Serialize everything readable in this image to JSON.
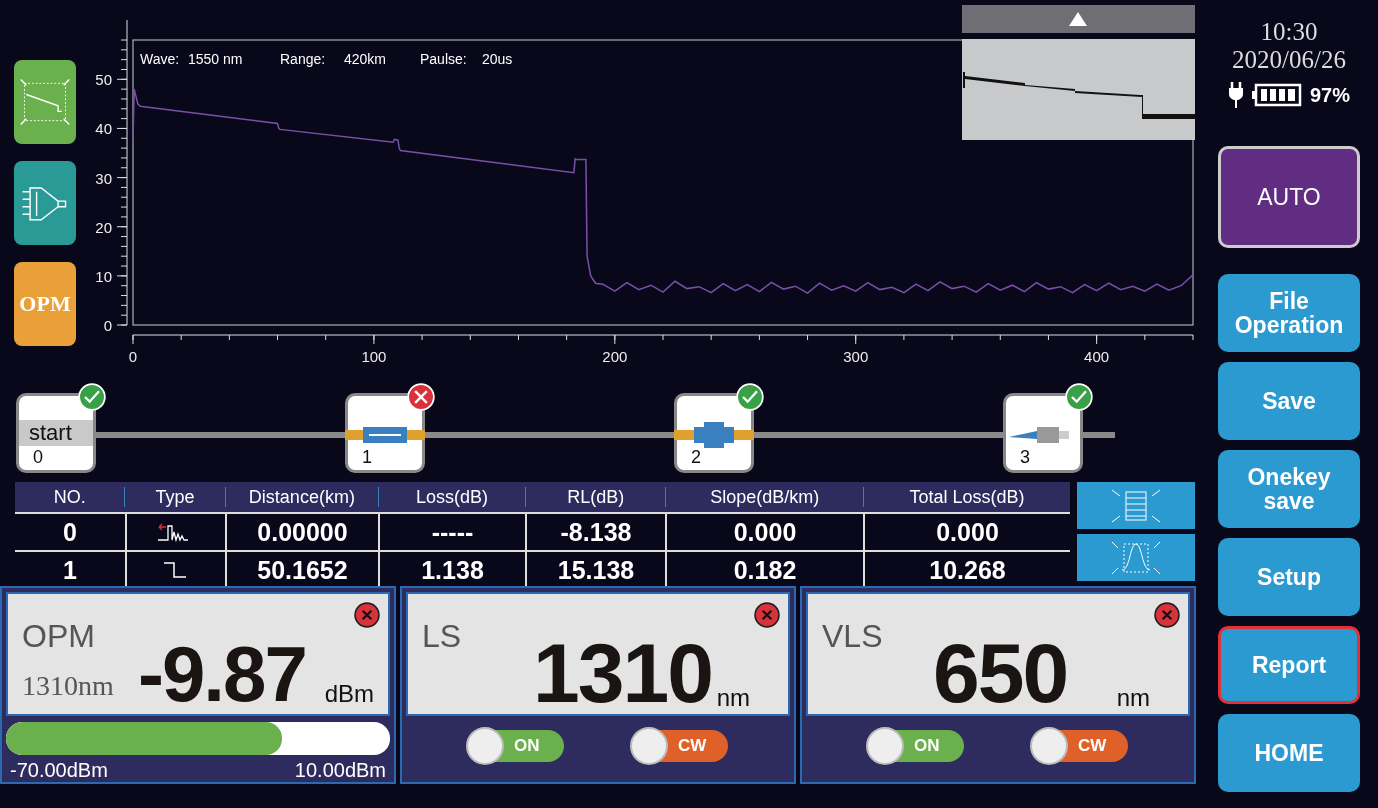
{
  "tool_buttons": [
    {
      "kind": "trace"
    },
    {
      "kind": "splitter"
    },
    {
      "kind": "text",
      "label": "OPM"
    }
  ],
  "chart": {
    "header": [
      {
        "label": "Wave:",
        "value": "1550 nm"
      },
      {
        "label": "Range:",
        "value": "420km"
      },
      {
        "label": "Paulse:",
        "value": "20us"
      }
    ],
    "chart_data": {
      "type": "line",
      "xlim": [
        0,
        440
      ],
      "ylim": [
        0,
        58
      ],
      "xticks": [
        0,
        100,
        200,
        300,
        400
      ],
      "yticks": [
        0,
        10,
        20,
        30,
        40,
        50
      ],
      "x": [
        0,
        0.5,
        1,
        2,
        3,
        60,
        60.5,
        61,
        108,
        108.5,
        110,
        110.5,
        111,
        183,
        183.5,
        184,
        188,
        188.5,
        190,
        192,
        195,
        200,
        205,
        210,
        215,
        220,
        225,
        230,
        235,
        240,
        245,
        250,
        255,
        260,
        265,
        270,
        275,
        280,
        285,
        290,
        295,
        300,
        305,
        310,
        315,
        320,
        325,
        330,
        335,
        340,
        345,
        350,
        355,
        360,
        365,
        370,
        375,
        380,
        385,
        390,
        395,
        400,
        405,
        410,
        415,
        420,
        425,
        430,
        435,
        440
      ],
      "series": [
        {
          "color": "#7b4fa8",
          "values": [
            38,
            48,
            47,
            45,
            44.5,
            41,
            40,
            39.8,
            37.2,
            37.8,
            37.6,
            36,
            35.5,
            31,
            33.8,
            33.7,
            33.7,
            14,
            10,
            8.5,
            8.3,
            6.9,
            8.6,
            7.2,
            8.1,
            6.7,
            8.9,
            7.4,
            7.8,
            6.6,
            8.4,
            7.0,
            8.2,
            6.8,
            8.7,
            7.3,
            7.9,
            6.5,
            8.5,
            7.1,
            8.0,
            6.9,
            8.6,
            7.2,
            7.7,
            6.6,
            8.3,
            7.0,
            8.8,
            7.4,
            7.9,
            6.7,
            8.4,
            7.1,
            8.1,
            6.8,
            8.6,
            7.3,
            7.8,
            6.6,
            8.2,
            7.0,
            8.5,
            7.2,
            7.9,
            6.9,
            8.3,
            7.1,
            8.0,
            10.2
          ]
        }
      ]
    }
  },
  "clock": {
    "time": "10:30",
    "date": "2020/06/26",
    "battery": "97%"
  },
  "side_buttons": [
    {
      "label": "AUTO",
      "kind": "mode",
      "selected": false
    },
    {
      "label": "File Operation",
      "kind": "action",
      "selected": false
    },
    {
      "label": "Save",
      "kind": "action",
      "selected": false
    },
    {
      "label": "Onekey save",
      "kind": "action",
      "selected": false
    },
    {
      "label": "Setup",
      "kind": "action",
      "selected": false
    },
    {
      "label": "Report",
      "kind": "action",
      "selected": true
    },
    {
      "label": "HOME",
      "kind": "action",
      "selected": false
    }
  ],
  "events": [
    {
      "kind": "start",
      "label": "start",
      "number": "0",
      "ok": true
    },
    {
      "kind": "splice",
      "number": "1",
      "ok": false
    },
    {
      "kind": "connector",
      "number": "2",
      "ok": true
    },
    {
      "kind": "end",
      "number": "3",
      "ok": true
    }
  ],
  "table": {
    "columns": [
      "NO.",
      "Type",
      "Distance(km)",
      "Loss(dB)",
      "RL(dB)",
      "Slope(dB/km)",
      "Total Loss(dB)"
    ],
    "rows": [
      {
        "no": "0",
        "kind": "reflective",
        "distance": "0.00000",
        "loss": "-----",
        "rl": "-8.138",
        "slope": "0.000",
        "total": "0.000"
      },
      {
        "no": "1",
        "kind": "step",
        "distance": "50.1652",
        "loss": "1.138",
        "rl": "15.138",
        "slope": "0.182",
        "total": "10.268"
      }
    ]
  },
  "table_tools": [
    {
      "kind": "fit"
    },
    {
      "kind": "peak"
    }
  ],
  "panels": [
    {
      "kind": "meter",
      "title": "OPM",
      "wavelength": "1310nm",
      "value": "-9.87",
      "unit": "dBm",
      "level": 0.72,
      "min": "-70.00dBm",
      "max": "10.00dBm"
    },
    {
      "kind": "source",
      "title": "LS",
      "value": "1310",
      "unit": "nm",
      "toggles": [
        {
          "label": "ON",
          "color": "#6ab04c"
        },
        {
          "label": "CW",
          "color": "#e0602a"
        }
      ]
    },
    {
      "kind": "source",
      "title": "VLS",
      "value": "650",
      "unit": "nm",
      "toggles": [
        {
          "label": "ON",
          "color": "#6ab04c"
        },
        {
          "label": "CW",
          "color": "#e0602a"
        }
      ]
    }
  ]
}
